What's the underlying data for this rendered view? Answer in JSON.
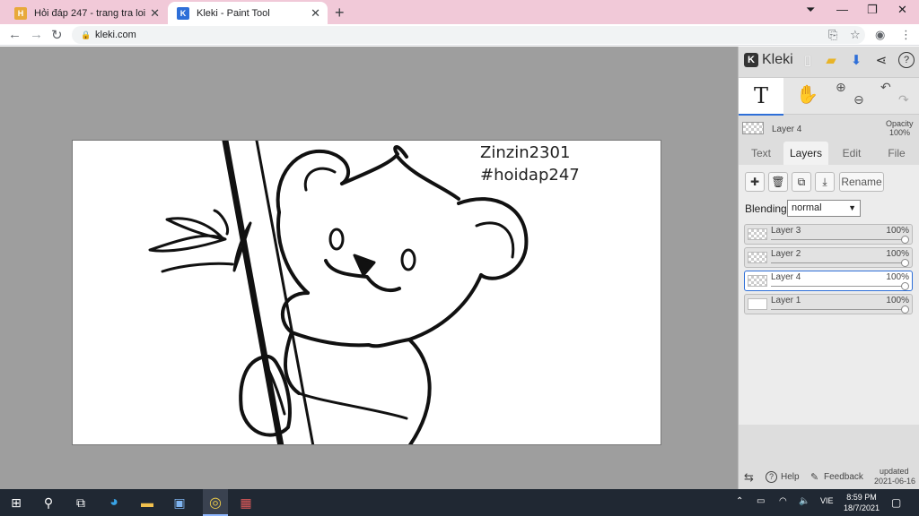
{
  "browser": {
    "tabs": [
      {
        "title": "Hỏi đáp 247 - trang tra loi"
      },
      {
        "title": "Kleki - Paint Tool"
      }
    ],
    "url": "kleki.com"
  },
  "canvas": {
    "signature_line1": "Zinzin2301",
    "signature_line2": "#hoidap247"
  },
  "panel": {
    "brand": "Kleki",
    "current_layer": "Layer 4",
    "opacity_label": "Opacity",
    "opacity_value": "100%",
    "tabs": [
      "Text",
      "Layers",
      "Edit",
      "File"
    ],
    "active_tab": "Layers",
    "rename_label": "Rename",
    "blending_label": "Blending",
    "blending_value": "normal",
    "layers": [
      {
        "name": "Layer 3",
        "opacity": "100%",
        "selected": false
      },
      {
        "name": "Layer 2",
        "opacity": "100%",
        "selected": false
      },
      {
        "name": "Layer 4",
        "opacity": "100%",
        "selected": true
      },
      {
        "name": "Layer 1",
        "opacity": "100%",
        "selected": false
      }
    ],
    "help_label": "Help",
    "feedback_label": "Feedback",
    "updated_label": "updated",
    "updated_date": "2021-06-16"
  },
  "taskbar": {
    "language": "VIE",
    "time": "8:59 PM",
    "date": "18/7/2021"
  },
  "colors": {
    "tab_strip": "#f1c9d8",
    "workspace": "#9e9e9e",
    "accent": "#2e6fd8",
    "taskbar": "#202833"
  }
}
